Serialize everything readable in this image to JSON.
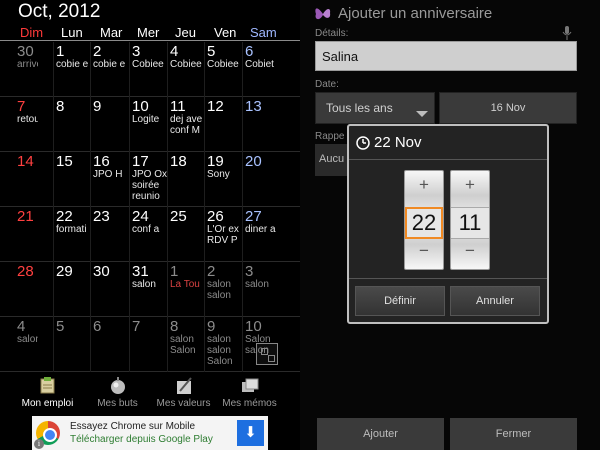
{
  "calendar": {
    "month_title": "Oct, 2012",
    "weekdays": [
      "Dim",
      "Lun",
      "Mar",
      "Mer",
      "Jeu",
      "Ven",
      "Sam"
    ],
    "weeks": [
      [
        {
          "day": "30",
          "events": [
            "arrivée"
          ],
          "other": true
        },
        {
          "day": "1",
          "events": [
            "cobie e"
          ]
        },
        {
          "day": "2",
          "events": [
            "cobie e"
          ]
        },
        {
          "day": "3",
          "events": [
            "Cobiee"
          ]
        },
        {
          "day": "4",
          "events": [
            "Cobiee"
          ]
        },
        {
          "day": "5",
          "events": [
            "Cobiee"
          ]
        },
        {
          "day": "6",
          "events": [
            "Cobiet"
          ]
        }
      ],
      [
        {
          "day": "7",
          "events": [
            "retour"
          ]
        },
        {
          "day": "8",
          "events": []
        },
        {
          "day": "9",
          "events": []
        },
        {
          "day": "10",
          "events": [
            "Logite"
          ]
        },
        {
          "day": "11",
          "events": [
            "dej ave",
            "conf M"
          ]
        },
        {
          "day": "12",
          "events": []
        },
        {
          "day": "13",
          "events": []
        }
      ],
      [
        {
          "day": "14",
          "events": []
        },
        {
          "day": "15",
          "events": []
        },
        {
          "day": "16",
          "events": [
            "JPO H"
          ]
        },
        {
          "day": "17",
          "events": [
            "JPO Ox",
            "soirée",
            "reunio"
          ]
        },
        {
          "day": "18",
          "events": []
        },
        {
          "day": "19",
          "events": [
            "Sony"
          ]
        },
        {
          "day": "20",
          "events": []
        }
      ],
      [
        {
          "day": "21",
          "events": []
        },
        {
          "day": "22",
          "events": [
            "formati"
          ]
        },
        {
          "day": "23",
          "events": []
        },
        {
          "day": "24",
          "events": [
            "conf a"
          ]
        },
        {
          "day": "25",
          "events": []
        },
        {
          "day": "26",
          "events": [
            "L'Or ex",
            "RDV P"
          ]
        },
        {
          "day": "27",
          "events": [
            "diner a"
          ]
        }
      ],
      [
        {
          "day": "28",
          "events": []
        },
        {
          "day": "29",
          "events": []
        },
        {
          "day": "30",
          "events": []
        },
        {
          "day": "31",
          "events": [
            "salon"
          ]
        },
        {
          "day": "1",
          "events": [
            "La Tou"
          ],
          "other": true,
          "red_event": true
        },
        {
          "day": "2",
          "events": [
            "salon",
            "salon"
          ],
          "other": true
        },
        {
          "day": "3",
          "events": [
            "salon"
          ],
          "other": true
        }
      ],
      [
        {
          "day": "4",
          "events": [
            "salon"
          ],
          "other": true
        },
        {
          "day": "5",
          "events": [],
          "other": true
        },
        {
          "day": "6",
          "events": [],
          "other": true
        },
        {
          "day": "7",
          "events": [],
          "other": true
        },
        {
          "day": "8",
          "events": [
            "salon",
            "Salon"
          ],
          "other": true
        },
        {
          "day": "9",
          "events": [
            "salon",
            "salon",
            "Salon"
          ],
          "other": true
        },
        {
          "day": "10",
          "events": [
            "Salon",
            "salon"
          ],
          "other": true
        }
      ]
    ]
  },
  "bottom_nav": [
    {
      "label": "Mon emploi",
      "icon": "schedule-icon",
      "active": true
    },
    {
      "label": "Mes buts",
      "icon": "goals-icon",
      "active": false
    },
    {
      "label": "Mes valeurs",
      "icon": "values-icon",
      "active": false
    },
    {
      "label": "Mes mémos",
      "icon": "memos-icon",
      "active": false
    }
  ],
  "ad": {
    "title": "Essayez Chrome sur Mobile",
    "subtitle": "Télécharger depuis Google Play",
    "download_glyph": "⬇",
    "info_glyph": "i"
  },
  "form": {
    "title": "Ajouter un anniversaire",
    "details_label": "Détails:",
    "details_value": "Salina",
    "date_label": "Date:",
    "repeat_value": "Tous les ans",
    "date_value": "16 Nov",
    "reminder_label": "Rappe",
    "reminder_value": "Aucu",
    "add_button": "Ajouter",
    "close_button": "Fermer"
  },
  "dialog": {
    "title": "22 Nov",
    "day_value": "22",
    "month_value": "11",
    "plus_glyph": "+",
    "minus_glyph": "−",
    "set_button": "Définir",
    "cancel_button": "Annuler"
  }
}
